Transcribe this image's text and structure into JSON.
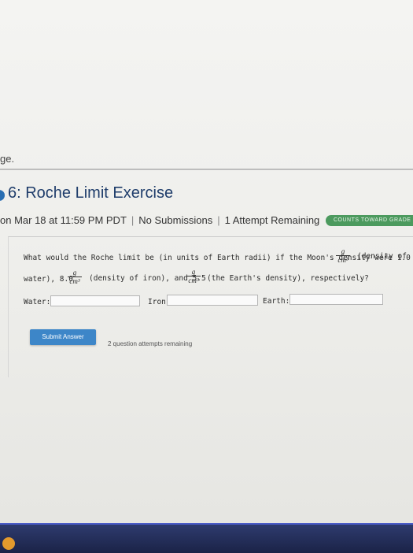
{
  "page": {
    "top_fragment": "ge.",
    "title": "6: Roche Limit Exercise",
    "due": "on Mar 18 at 11:59 PM PDT",
    "submissions": "No Submissions",
    "attempts_remaining": "1 Attempt Remaining",
    "badge": "COUNTS TOWARD GRADE"
  },
  "question": {
    "line1": "What would the Roche limit be (in units of Earth radii) if the Moon's density were 1.0",
    "line1_tail": "(density of",
    "line2_a": "water), 8.0",
    "line2_b": "(density of iron), and 5.5",
    "line2_c": "(the Earth's density), respectively?",
    "unit_num": "g",
    "unit_den": "cm³"
  },
  "fields": {
    "water_label": "Water:",
    "iron_label": "Iron:",
    "earth_label": "Earth:",
    "water_value": "",
    "iron_value": "",
    "earth_value": ""
  },
  "actions": {
    "submit_label": "Submit Answer",
    "attempts_note": "2 question attempts remaining"
  }
}
